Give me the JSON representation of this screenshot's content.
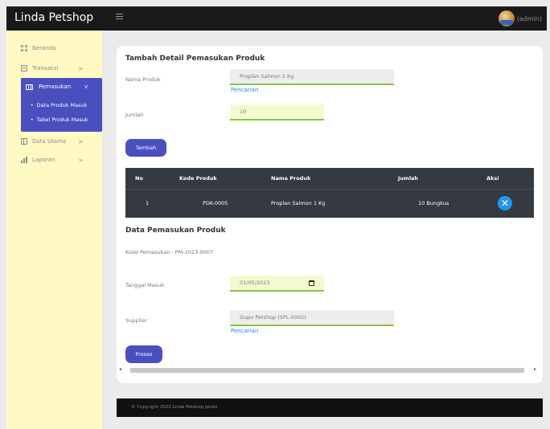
{
  "header": {
    "brand": "Linda Petshop",
    "user_name": "(admin)"
  },
  "sidebar": {
    "items": [
      {
        "label": "Beranda",
        "icon": "grid-icon"
      },
      {
        "label": "Transaksi",
        "icon": "receipt-icon",
        "chevron": ">"
      },
      {
        "label": "Pemasukan",
        "icon": "table-icon",
        "chevron": "v",
        "active": true,
        "children": [
          "Data Produk Masuk",
          "Tabel Produk Masuk"
        ]
      },
      {
        "label": "Data Utama",
        "icon": "table-plus-icon",
        "chevron": ">"
      },
      {
        "label": "Laporan",
        "icon": "bar-chart-icon",
        "chevron": ">"
      }
    ]
  },
  "detail_form": {
    "title": "Tambah Detail Pemasukan Produk",
    "product_label": "Nama Produk",
    "product_value": "Proplan Salmon 1 Kg",
    "product_search": "Pencarian",
    "qty_label": "Jumlah",
    "qty_value": "10",
    "add_button": "Tambah"
  },
  "table": {
    "headers": [
      "No",
      "Kode Produk",
      "Nama Produk",
      "Jumlah",
      "Aksi"
    ],
    "rows": [
      {
        "no": "1",
        "code": "PDK-0005",
        "name": "Proplan Salmon 1 Kg",
        "qty": "10 Bungkus"
      }
    ]
  },
  "income_form": {
    "title": "Data Pemasukan Produk",
    "code_text": "Kode Pemasukan : PM-2023-0007",
    "date_label": "Tanggal Masuk",
    "date_value": "01/05/2023",
    "supplier_label": "Supplier",
    "supplier_value": "Gupo Petshop (SPL-0002)",
    "supplier_search": "Pencarian",
    "process_button": "Proses"
  },
  "footer": {
    "text": "© Copyright 2022 Linda Petshop Jambi"
  },
  "colors": {
    "topbar": "#1a1a1a",
    "sidebar": "#fff9c4",
    "accent": "#4a4fc0",
    "table_bg": "#343a40",
    "link": "#1e88e5",
    "delete": "#2196f3",
    "input_underline": "#8bc34a"
  }
}
